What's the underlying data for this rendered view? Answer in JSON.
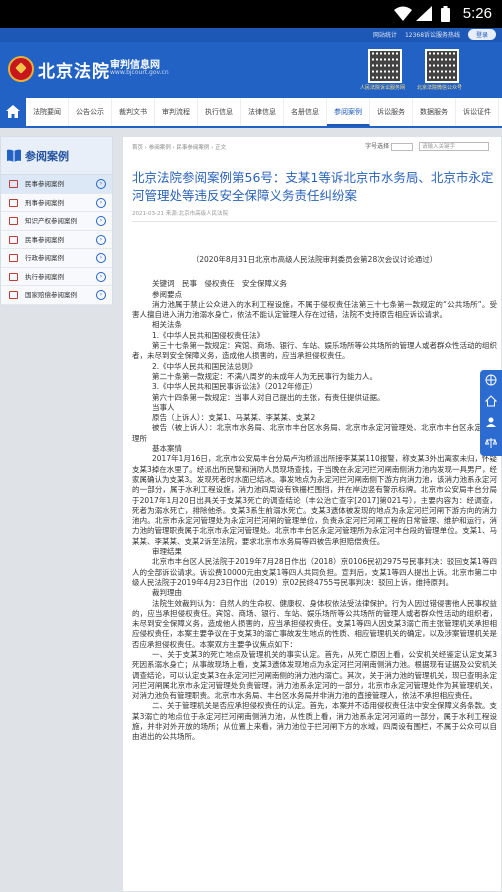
{
  "status_bar": {
    "time": "5:26"
  },
  "topbar": {
    "link1": "网站统计",
    "hotline": "12368诉讼服务热线",
    "login": "登录"
  },
  "header": {
    "site_name": "北京法院",
    "subtitle": "审判信息网",
    "url": "www.bjcourt.gov.cn",
    "qr1_caption": "人民法院诉讼服务网",
    "qr2_caption": "北京法院微信公众号"
  },
  "nav": {
    "items": [
      "法院要闻",
      "公告公示",
      "裁判文书",
      "审判流程",
      "执行信息",
      "法律信息",
      "名册信息",
      "参阅案例",
      "诉讼服务",
      "数据服务",
      "诉讼证件"
    ],
    "active_index": 7
  },
  "sidebar": {
    "title": "参阅案例",
    "items": [
      "民事参阅案例",
      "刑事参阅案例",
      "知识产权参阅案例",
      "民事参阅案例",
      "行政参阅案例",
      "执行参阅案例",
      "国家赔偿参阅案例"
    ],
    "active_index": 0
  },
  "article": {
    "breadcrumb": "首页 › 参阅案例 › 民事参阅案例 › 正文",
    "tools_label": "字号选择",
    "search_placeholder": "请输入关键字",
    "title": "北京法院参阅案例第56号：支某1等诉北京市水务局、北京市永定河管理处等违反安全保障义务责任纠纷案",
    "meta": "2021-03-21 来源:北京市高级人民法院",
    "paragraphs": [
      {
        "cls": "c",
        "text": "（2020年8月31日北京市高级人民法院审判委员会第28次会议讨论通过）"
      },
      {
        "cls": "ind1",
        "text": "关键词　民事　侵权责任　安全保障义务"
      },
      {
        "cls": "ind1",
        "text": "参阅要点"
      },
      {
        "cls": "ind2",
        "text": "消力池属于禁止公众进入的水利工程设施，不属于侵权责任法第三十七条第一款规定的“公共场所”。受害人擅自进入消力池溺水身亡，依法不能认定管理人存在过错，法院不支持原告相应诉讼请求。"
      },
      {
        "cls": "ind1",
        "text": "相关法条"
      },
      {
        "cls": "ind1",
        "text": "1.《中华人民共和国侵权责任法》"
      },
      {
        "cls": "ind2",
        "text": "第三十七条第一款规定：宾馆、商场、银行、车站、娱乐场所等公共场所的管理人或者群众性活动的组织者，未尽到安全保障义务，造成他人损害的，应当承担侵权责任。"
      },
      {
        "cls": "ind1",
        "text": "2.《中华人民共和国民法总则》"
      },
      {
        "cls": "ind1",
        "text": "第二十条第一款规定：不满八周岁的未成年人为无民事行为能力人。"
      },
      {
        "cls": "ind1",
        "text": "3.《中华人民共和国民事诉讼法》（2012年修正）"
      },
      {
        "cls": "ind1",
        "text": "第六十四条第一款规定：当事人对自己提出的主张，有责任提供证据。"
      },
      {
        "cls": "ind1",
        "text": "当事人"
      },
      {
        "cls": "ind1",
        "text": "原告（上诉人）：支某1、马某某、李某某、支某2"
      },
      {
        "cls": "ind2",
        "text": "被告（被上诉人）：北京市水务局、北京市丰台区水务局、北京市永定河管理处、北京市丰台区永定河管理所"
      },
      {
        "cls": "ind1",
        "text": "基本案情"
      },
      {
        "cls": "ind2",
        "text": "2017年1月16日，北京市公安局丰台分局卢沟桥派出所接李某某110报警，称支某3外出离家未归，怀疑支某3掉在水里了。经派出所民警和消防人员现场查找，于当晚在永定河拦河闸南侧消力池内发现一具男尸，经家属确认为支某3。发现死者时水面已结冰。事发地点为永定河拦河闸南侧下游方向消力池，该消力池系永定河的一部分，属于水利工程设施，消力池四周设有铁栅栏围挡，并在岸边竖有警示标牌。北京市公安局丰台分局于2017年1月20日出具关于支某3死亡的调查结论（丰公治亡查字[2017]第021号），主要内容为：经调查，死者为溺水死亡，排除他杀。支某3系生前溺水死亡。支某3遗体被发现的地点为永定河拦河闸下游方向的消力池内。北京市永定河管理处为永定河拦河闸的管理单位，负责永定河拦河闸工程的日常管理、维护和运行，消力池的管理职责属于北京市永定河管理处。北京市丰台区永定河管理所为永定河丰台段的管理单位。支某1、马某某、李某某、支某2诉至法院，要求北京市水务局等四被告承担赔偿责任。"
      },
      {
        "cls": "ind1",
        "text": "审理结果"
      },
      {
        "cls": "ind2",
        "text": "北京市丰台区人民法院于2019年7月28日作出（2018）京0106民初2975号民事判决：驳回支某1等四人的全部诉讼请求。诉讼费10000元由支某1等四人共同负担。宣判后，支某1等四人提出上诉。北京市第二中级人民法院于2019年4月23日作出（2019）京02民终4755号民事判决：驳回上诉，维持原判。"
      },
      {
        "cls": "ind1",
        "text": "裁判理由"
      },
      {
        "cls": "ind2",
        "text": "法院生效裁判认为：自然人的生命权、健康权、身体权依法受法律保护。行为人因过错侵害他人民事权益的，应当承担侵权责任。宾馆、商场、银行、车站、娱乐场所等公共场所的管理人或者群众性活动的组织者，未尽到安全保障义务，造成他人损害的，应当承担侵权责任。支某1等四人因支某3溺亡而主张管理机关承担相应侵权责任，本案主要争议在于支某3的溺亡事故发生地点的性质、相应管理机关的确定，以及涉案管理机关是否应承担侵权责任。本案双方主要争议焦点如下："
      },
      {
        "cls": "ind2",
        "text": "一、关于支某3的死亡地点及管理机关的事实认定。首先，从死亡原因上看，公安机关经鉴定认定支某3死因系溺水身亡；从事故现场上看，支某3遗体发现地点为永定河拦河闸南侧消力池。根据现有证据及公安机关调查结论，可以认定支某3在永定河拦河闸南侧的消力池内溺亡。其次，关于消力池的管理机关，现已查明永定河拦河闸属北京市永定河管理处负责管理，消力池系永定河的一部分，北京市永定河管理处作为其管理机关，对消力池负有管理职责。北京市水务局、丰台区水务局并非消力池的直接管理人，依法不承担相应责任。"
      },
      {
        "cls": "ind2",
        "text": "二、关于管理机关是否应承担侵权责任的认定。首先，本案并不适用侵权责任法中安全保障义务条款。支某3溺亡的地点位于永定河拦河闸南侧消力池，从性质上看，消力池系永定河河道的一部分，属于水利工程设施，并非对外开放的场所；从位置上来看，消力池位于拦河闸下方的水域，四周设有围栏，不属于公众可以自由进出的公共场所。"
      }
    ]
  }
}
